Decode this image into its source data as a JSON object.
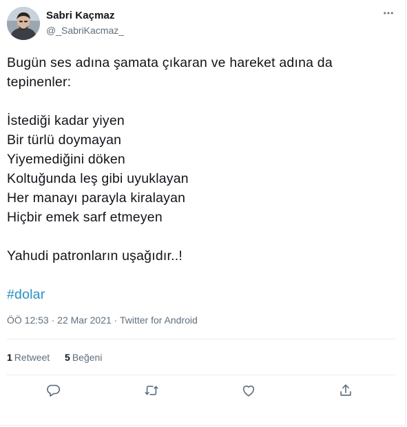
{
  "user": {
    "display_name": "Sabri Kaçmaz",
    "handle": "@_SabriKacmaz_"
  },
  "tweet": {
    "lines": [
      "Bugün ses adına şamata çıkaran ve hareket adına da",
      "tepinenler:",
      "",
      "İstediği kadar yiyen",
      "Bir türlü doymayan",
      "Yiyemediğini döken",
      "Koltuğunda leş gibi uyuklayan",
      "Her manayı parayla kiralayan",
      "Hiçbir emek sarf etmeyen",
      "",
      "Yahudi patronların uşağıdır..!",
      ""
    ],
    "hashtag": "#dolar"
  },
  "meta": {
    "time": "ÖÖ 12:53",
    "separator": " · ",
    "date": "22 Mar 2021",
    "source": "Twitter for Android"
  },
  "stats": {
    "retweets_count": "1",
    "retweets_label": "Retweet",
    "likes_count": "5",
    "likes_label": "Beğeni"
  },
  "icons": {
    "more": "more-horizontal-icon",
    "reply": "reply-icon",
    "retweet": "retweet-icon",
    "like": "heart-icon",
    "share": "share-icon"
  },
  "colors": {
    "text": "#0f1419",
    "secondary": "#5b7083",
    "link": "#1b95e0",
    "border": "#e6ecf0"
  }
}
